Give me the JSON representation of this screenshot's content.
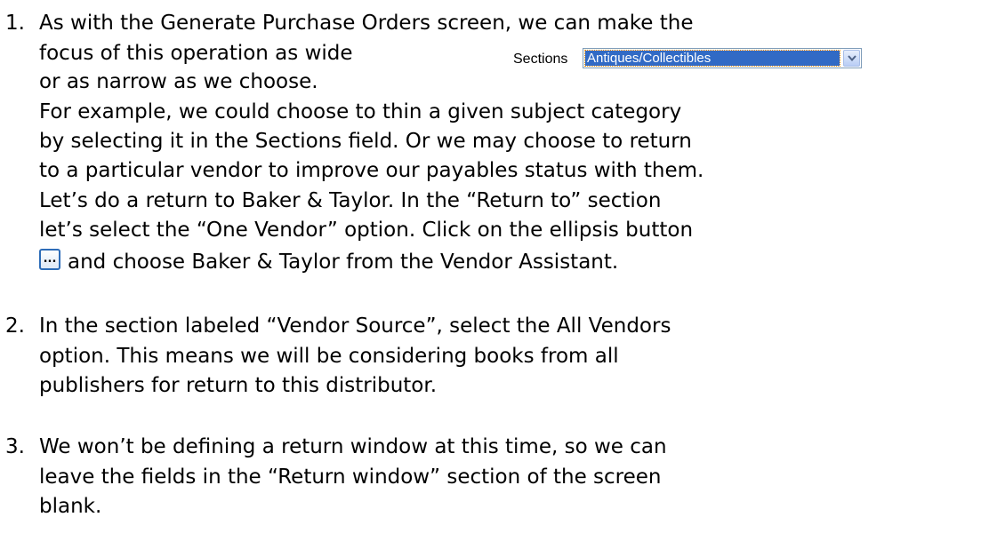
{
  "items": [
    {
      "number": "1.",
      "lines": [
        "As with the Generate Purchase Orders screen, we can make the",
        "focus of this operation as wide",
        "or as narrow as we choose.",
        "For example, we could choose to thin a given subject category",
        "by selecting it in the Sections field.  Or we may choose to return",
        "to a particular vendor to improve our payables status with them.",
        "Let’s do a return to Baker & Taylor.  In the “Return to” section",
        "let’s select the “One Vendor” option. Click on the ellipsis button",
        "and choose Baker & Taylor from the Vendor Assistant."
      ]
    },
    {
      "number": "2.",
      "lines": [
        "In the section labeled “Vendor Source”, select the All Vendors",
        "option.  This means we will be considering books from all",
        "publishers for return to this distributor."
      ]
    },
    {
      "number": "3.",
      "lines": [
        "We won’t be defining a return window at this time, so we can",
        "leave the fields in the “Return window” section of the screen",
        "blank."
      ]
    }
  ],
  "sections_field": {
    "label": "Sections",
    "value": "Antiques/Collectibles",
    "highlight_color": "#316ac5",
    "arrow_icon": "chevron-down-icon"
  },
  "ellipsis_button": {
    "label": "...",
    "icon": "ellipsis-icon",
    "border_color": "#2e6db8"
  }
}
